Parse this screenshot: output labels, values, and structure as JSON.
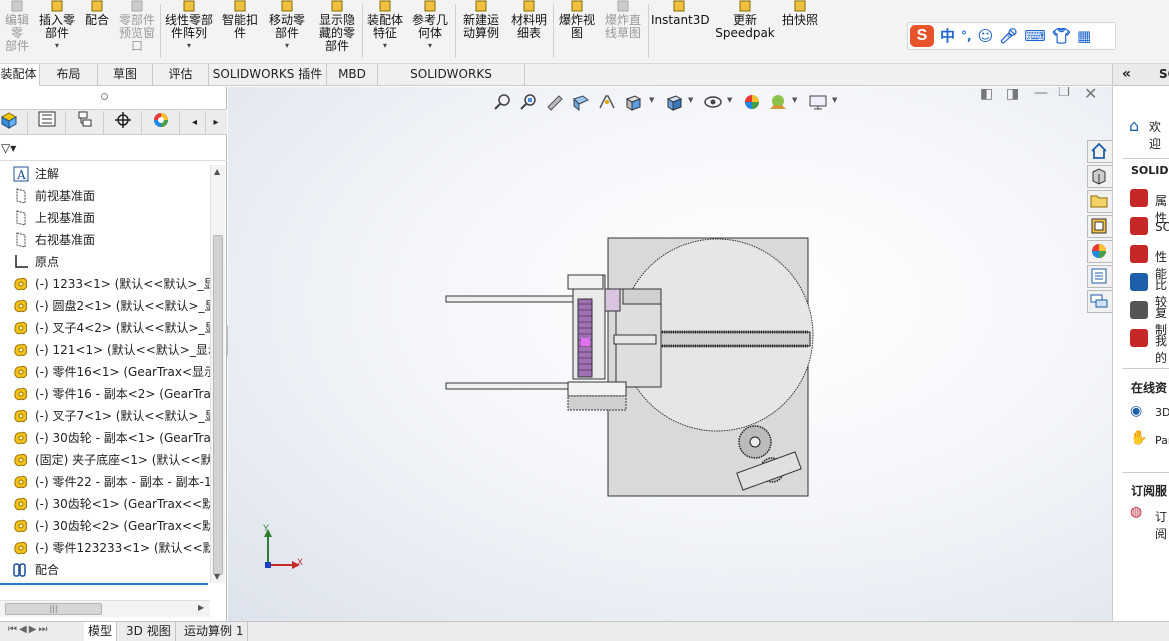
{
  "ribbon": {
    "buttons": [
      {
        "label": "编辑零\n部件",
        "disabled": true
      },
      {
        "label": "插入零\n部件",
        "disabled": false
      },
      {
        "label": "配合",
        "disabled": false
      },
      {
        "label": "零部件\n预览窗\n口",
        "disabled": true
      },
      {
        "label": "线性零部\n件阵列",
        "disabled": false
      },
      {
        "label": "智能扣\n件",
        "disabled": false
      },
      {
        "label": "移动零\n部件",
        "disabled": false
      },
      {
        "label": "显示隐\n藏的零\n部件",
        "disabled": false
      },
      {
        "label": "装配体\n特征",
        "disabled": false
      },
      {
        "label": "参考几\n何体",
        "disabled": false
      },
      {
        "label": "新建运\n动算例",
        "disabled": false
      },
      {
        "label": "材料明\n细表",
        "disabled": false
      },
      {
        "label": "爆炸视\n图",
        "disabled": false
      },
      {
        "label": "爆炸直\n线草图",
        "disabled": true
      },
      {
        "label": "Instant3D",
        "disabled": false
      },
      {
        "label": "更新\nSpeedpak",
        "disabled": false
      },
      {
        "label": "拍快照",
        "disabled": false
      }
    ]
  },
  "ime": {
    "logo": "S",
    "mode": "中",
    "punct": "°,"
  },
  "tabs": [
    "装配体",
    "布局",
    "草图",
    "评估",
    "SOLIDWORKS 插件",
    "MBD",
    "SOLIDWORKS Inspection"
  ],
  "tree": {
    "items": [
      {
        "label": "注解",
        "icon": "annotation-icon"
      },
      {
        "label": "前视基准面",
        "icon": "plane-icon"
      },
      {
        "label": "上视基准面",
        "icon": "plane-icon"
      },
      {
        "label": "右视基准面",
        "icon": "plane-icon"
      },
      {
        "label": "原点",
        "icon": "origin-icon"
      },
      {
        "label": "(-) 1233<1> (默认<<默认>_显示",
        "icon": "part-icon"
      },
      {
        "label": "(-) 圆盘2<1> (默认<<默认>_显",
        "icon": "part-icon"
      },
      {
        "label": "(-) 叉子4<2> (默认<<默认>_显",
        "icon": "part-icon"
      },
      {
        "label": "(-) 121<1> (默认<<默认>_显示",
        "icon": "part-icon"
      },
      {
        "label": "(-) 零件16<1> (GearTrax<显示",
        "icon": "part-icon"
      },
      {
        "label": "(-) 零件16 - 副本<2> (GearTra",
        "icon": "part-icon"
      },
      {
        "label": "(-) 叉子7<1> (默认<<默认>_显",
        "icon": "part-icon"
      },
      {
        "label": "(-) 30齿轮 - 副本<1> (GearTra",
        "icon": "part-icon"
      },
      {
        "label": "(固定) 夹子底座<1> (默认<<默认",
        "icon": "part-icon"
      },
      {
        "label": "(-) 零件22 - 副本 - 副本 - 副本-1",
        "icon": "part-icon"
      },
      {
        "label": "(-) 30齿轮<1> (GearTrax<<默认",
        "icon": "part-icon"
      },
      {
        "label": "(-) 30齿轮<2> (GearTrax<<默认",
        "icon": "part-icon"
      },
      {
        "label": "(-) 零件123233<1> (默认<<默认",
        "icon": "part-icon"
      },
      {
        "label": "配合",
        "icon": "mates-icon"
      }
    ]
  },
  "bottom_tabs": [
    "模型",
    "3D 视图",
    "运动算例 1"
  ],
  "axes": {
    "x": "X",
    "y": "Y"
  },
  "taskpane": {
    "header": "SO",
    "welcome": "欢迎",
    "section1": "SOLIDW",
    "items1": [
      "属性",
      "SO",
      "性能",
      "比较",
      "复制",
      "我的"
    ],
    "section2": "在线资",
    "items2": [
      "3D",
      "Par"
    ],
    "section3": "订阅服",
    "items3": [
      "订阅"
    ]
  }
}
